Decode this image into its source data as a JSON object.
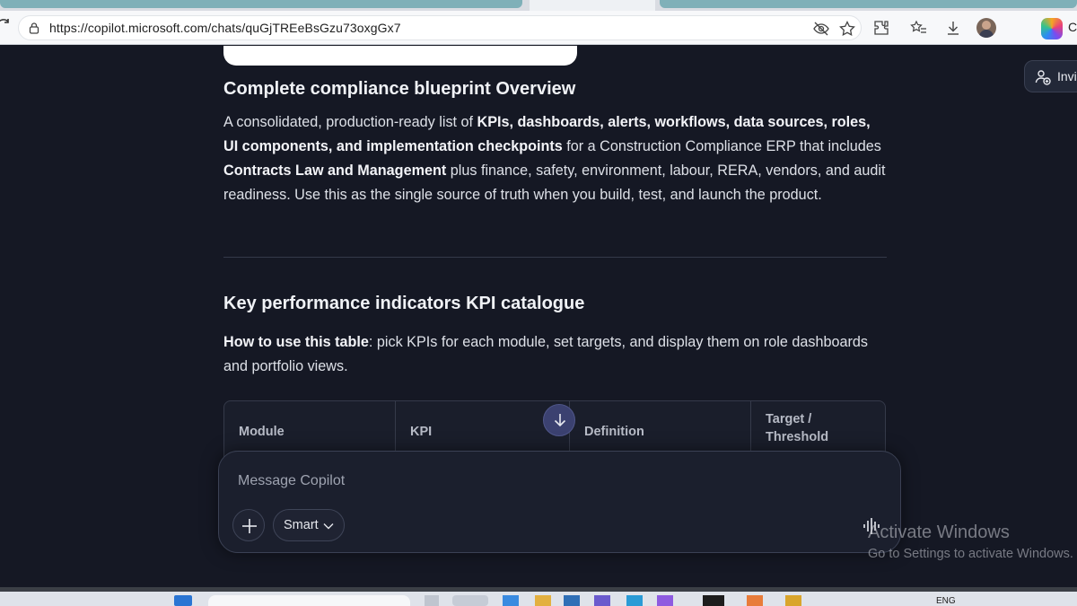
{
  "browser": {
    "url": "https://copilot.microsoft.com/chats/quGjTREeBsGzu73oxgGx7",
    "profile_fragment": "C"
  },
  "header": {
    "invite_label": "Invi"
  },
  "sections": {
    "overview": {
      "heading": "Complete compliance blueprint Overview",
      "p_pre": "A consolidated, production-ready list of ",
      "p_bold1": "KPIs, dashboards, alerts, workflows, data sources, roles, UI components, and implementation checkpoints",
      "p_mid": " for a Construction Compliance ERP that includes ",
      "p_bold2": "Contracts Law and Management",
      "p_post": " plus finance, safety, environment, labour, RERA, vendors, and audit readiness. Use this as the single source of truth when you build, test, and launch the product."
    },
    "kpi": {
      "heading": "Key performance indicators KPI catalogue",
      "p_bold": "How to use this table",
      "p_rest": ": pick KPIs for each module, set targets, and display them on role dashboards and portfolio views.",
      "columns": [
        "Module",
        "KPI",
        "Definition",
        "Target /\nThreshold"
      ]
    }
  },
  "composer": {
    "placeholder": "Message Copilot",
    "mode_label": "Smart"
  },
  "watermark": {
    "title": "Activate Windows",
    "subtitle": "Go to Settings to activate Windows."
  },
  "taskbar": {
    "lang": "ENG"
  }
}
